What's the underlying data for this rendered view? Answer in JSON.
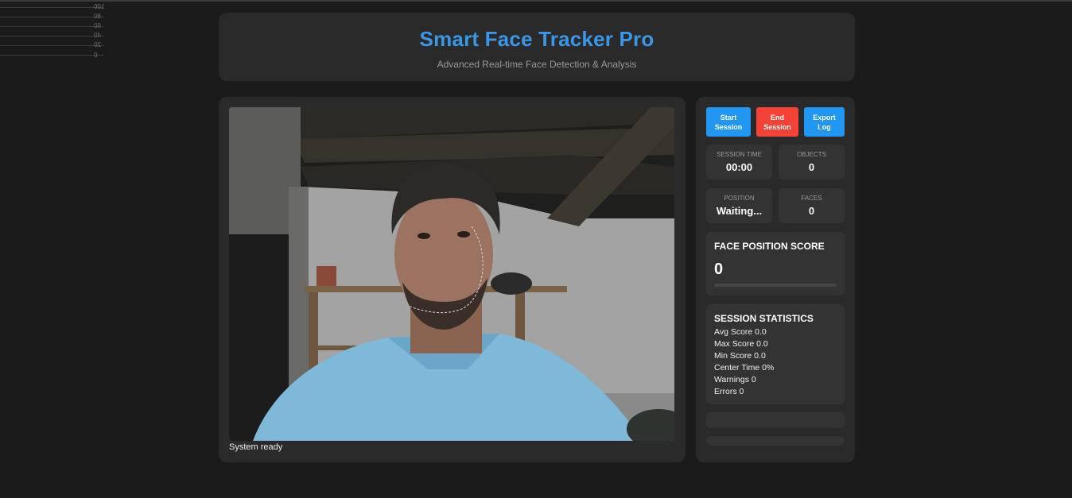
{
  "mini_chart": {
    "tick_labels": [
      "100",
      "80",
      "60",
      "40",
      "20",
      "0"
    ]
  },
  "header": {
    "title": "Smart Face Tracker Pro",
    "subtitle": "Advanced Real-time Face Detection & Analysis"
  },
  "video": {
    "status": "System ready"
  },
  "controls": {
    "start_label": "Start Session",
    "end_label": "End Session",
    "export_label": "Export Log"
  },
  "stats": {
    "session_time_label": "SESSION TIME",
    "session_time_value": "00:00",
    "objects_label": "OBJECTS",
    "objects_value": "0",
    "position_label": "POSITION",
    "position_value": "Waiting...",
    "faces_label": "FACES",
    "faces_value": "0"
  },
  "score": {
    "heading": "FACE POSITION SCORE",
    "value": "0",
    "progress_fraction": 0
  },
  "session_statistics": {
    "heading": "SESSION STATISTICS",
    "rows": [
      "Avg Score 0.0",
      "Max Score 0.0",
      "Min Score 0.0",
      "Center Time 0%",
      "Warnings 0",
      "Errors 0"
    ]
  },
  "colors": {
    "accent": "#3b97e6",
    "start_button": "#2196f3",
    "end_button": "#f44336",
    "panel": "#2a2a2a",
    "background": "#1b1b1b"
  }
}
